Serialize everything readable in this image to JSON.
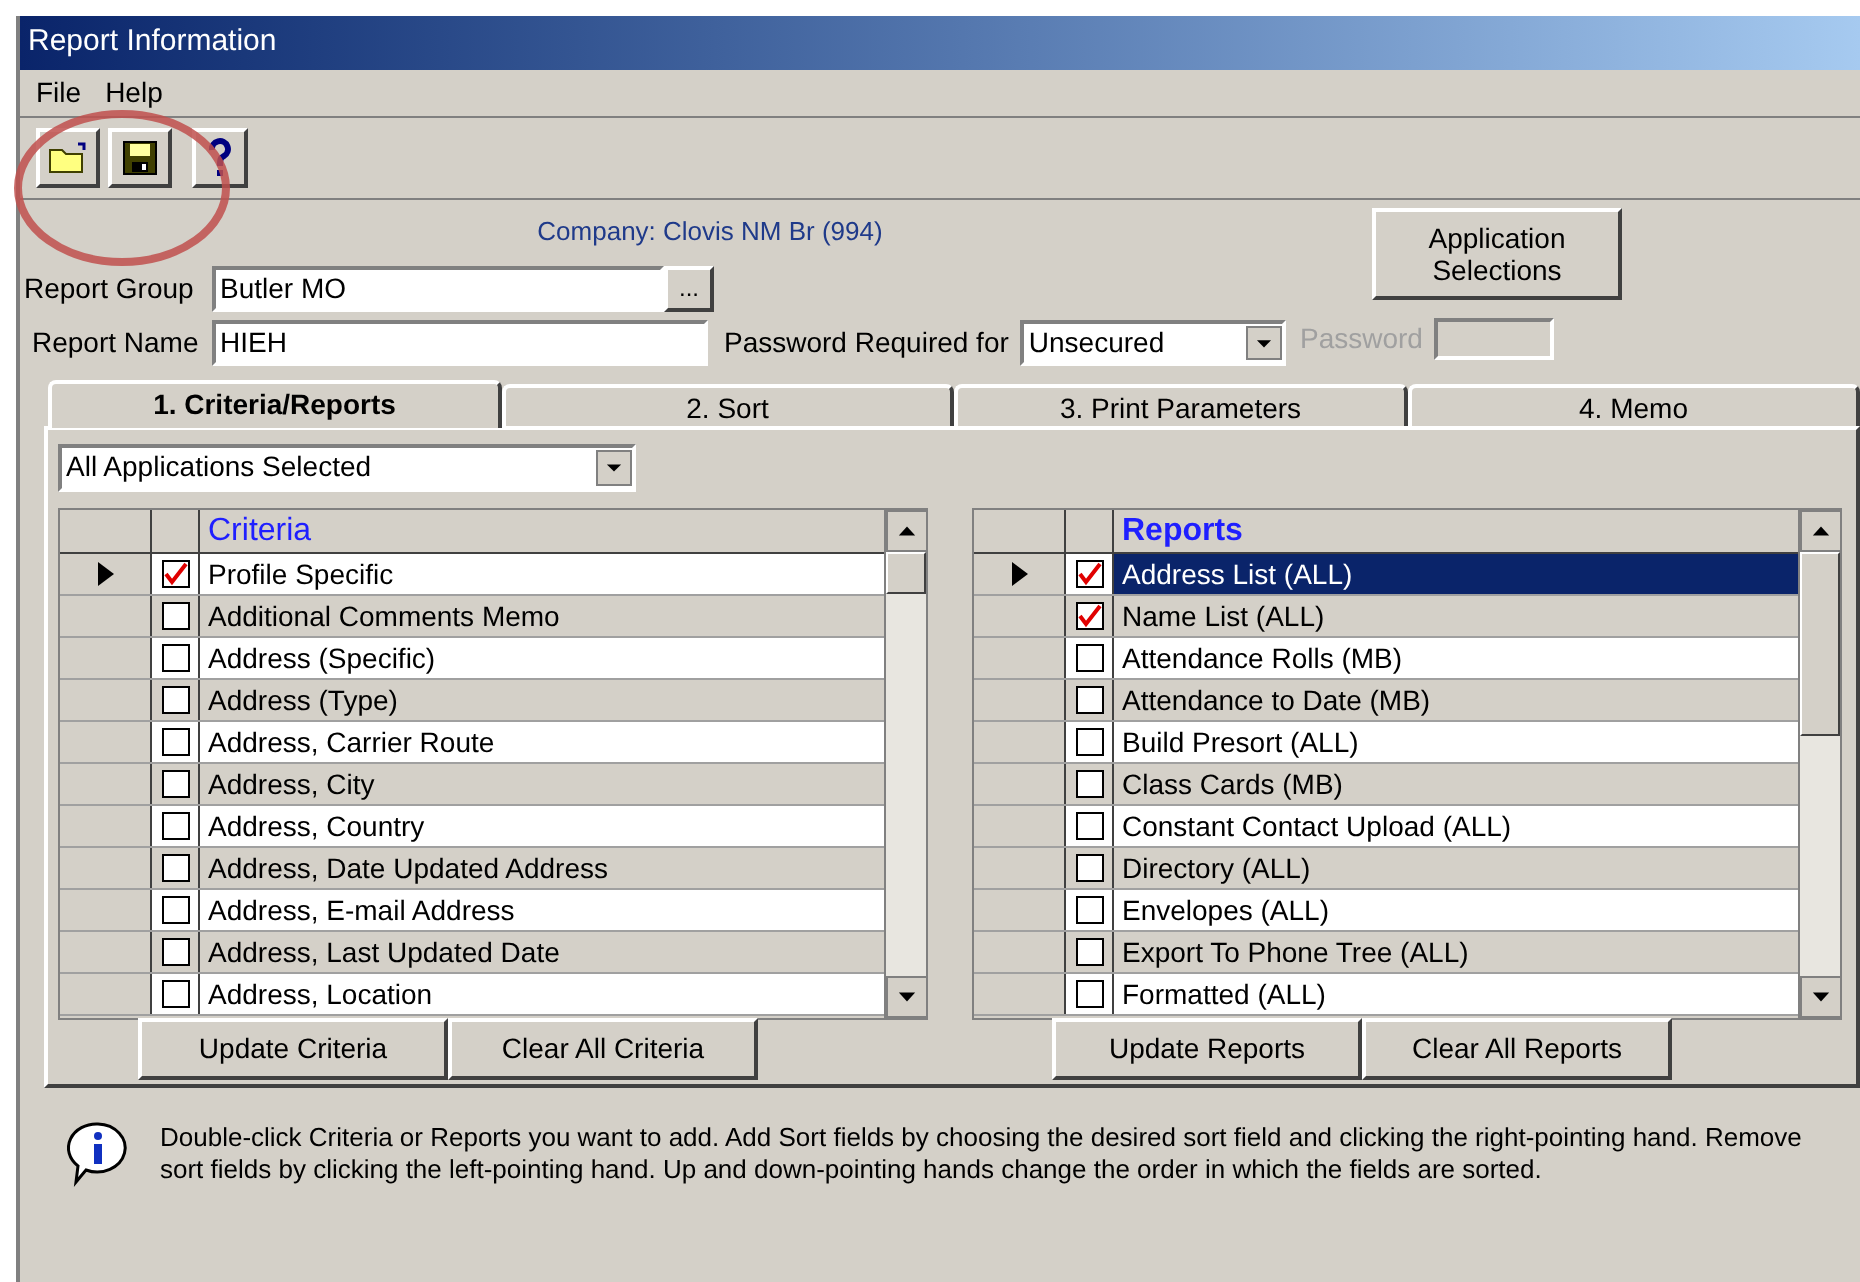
{
  "window": {
    "title": "Report Information"
  },
  "menu": [
    {
      "label": "File"
    },
    {
      "label": "Help"
    }
  ],
  "company": "Company: Clovis NM Br (994)",
  "report_group": {
    "label": "Report Group",
    "value": "Butler MO",
    "browse": "..."
  },
  "report_name": {
    "label": "Report Name",
    "value": "HIEH"
  },
  "password_required": {
    "label": "Password Required for",
    "value": "Unsecured"
  },
  "password": {
    "label": "Password",
    "disabled": true
  },
  "application_button": "Application Selections",
  "tabs": [
    {
      "label": "1. Criteria/Reports",
      "selected": true
    },
    {
      "label": "2. Sort",
      "selected": false
    },
    {
      "label": "3. Print Parameters",
      "selected": false
    },
    {
      "label": "4. Memo",
      "selected": false
    }
  ],
  "applications_filter": "All Applications Selected",
  "criteria": {
    "header": "Criteria",
    "rows": [
      {
        "text": "Profile Specific",
        "checked": true,
        "current": true,
        "selected": false
      },
      {
        "text": "Additional Comments Memo",
        "checked": false,
        "current": false,
        "selected": false
      },
      {
        "text": "Address (Specific)",
        "checked": false,
        "current": false,
        "selected": false
      },
      {
        "text": "Address (Type)",
        "checked": false,
        "current": false,
        "selected": false
      },
      {
        "text": "Address, Carrier Route",
        "checked": false,
        "current": false,
        "selected": false
      },
      {
        "text": "Address, City",
        "checked": false,
        "current": false,
        "selected": false
      },
      {
        "text": "Address, Country",
        "checked": false,
        "current": false,
        "selected": false
      },
      {
        "text": "Address, Date Updated Address",
        "checked": false,
        "current": false,
        "selected": false
      },
      {
        "text": "Address, E-mail Address",
        "checked": false,
        "current": false,
        "selected": false
      },
      {
        "text": "Address, Last Updated Date",
        "checked": false,
        "current": false,
        "selected": false
      },
      {
        "text": "Address, Location",
        "checked": false,
        "current": false,
        "selected": false
      }
    ],
    "buttons": [
      "Update Criteria",
      "Clear All Criteria"
    ]
  },
  "reports": {
    "header": "Reports",
    "rows": [
      {
        "text": "Address List (ALL)",
        "checked": true,
        "current": true,
        "selected": true
      },
      {
        "text": "Name List (ALL)",
        "checked": true,
        "current": false,
        "selected": false
      },
      {
        "text": "Attendance Rolls (MB)",
        "checked": false,
        "current": false,
        "selected": false
      },
      {
        "text": "Attendance to Date (MB)",
        "checked": false,
        "current": false,
        "selected": false
      },
      {
        "text": "Build Presort (ALL)",
        "checked": false,
        "current": false,
        "selected": false
      },
      {
        "text": "Class Cards (MB)",
        "checked": false,
        "current": false,
        "selected": false
      },
      {
        "text": "Constant Contact Upload (ALL)",
        "checked": false,
        "current": false,
        "selected": false
      },
      {
        "text": "Directory (ALL)",
        "checked": false,
        "current": false,
        "selected": false
      },
      {
        "text": "Envelopes (ALL)",
        "checked": false,
        "current": false,
        "selected": false
      },
      {
        "text": "Export To Phone Tree (ALL)",
        "checked": false,
        "current": false,
        "selected": false
      },
      {
        "text": "Formatted (ALL)",
        "checked": false,
        "current": false,
        "selected": false
      }
    ],
    "buttons": [
      "Update Reports",
      "Clear All Reports"
    ]
  },
  "info": "Double-click Criteria or Reports you want to add.  Add Sort fields by choosing the desired sort field and clicking the right-pointing hand. Remove sort fields by clicking the left-pointing hand.  Up and down-pointing hands change the order in which the fields are sorted."
}
